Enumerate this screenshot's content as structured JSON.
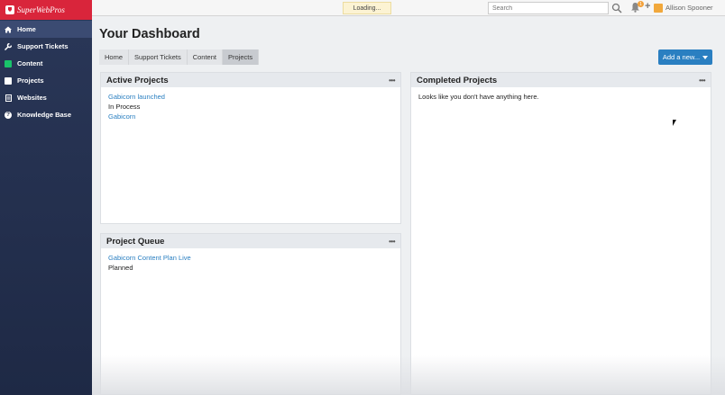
{
  "brand": {
    "name": "SuperWebPros",
    "color": "#d9253b"
  },
  "sidebar": {
    "items": [
      {
        "label": "Home",
        "icon": "home-icon",
        "active": true
      },
      {
        "label": "Support Tickets",
        "icon": "wrench-icon",
        "active": false
      },
      {
        "label": "Content",
        "icon": "content-icon",
        "active": false
      },
      {
        "label": "Projects",
        "icon": "projects-icon",
        "active": false
      },
      {
        "label": "Websites",
        "icon": "websites-icon",
        "active": false
      },
      {
        "label": "Knowledge Base",
        "icon": "question-icon",
        "active": false
      }
    ]
  },
  "topbar": {
    "loading_text": "Loading...",
    "search_placeholder": "Search",
    "notification_count": "1",
    "user_name": "Allison Spooner"
  },
  "main": {
    "title": "Your Dashboard",
    "tabs": [
      {
        "label": "Home",
        "active": false
      },
      {
        "label": "Support Tickets",
        "active": false
      },
      {
        "label": "Content",
        "active": false
      },
      {
        "label": "Projects",
        "active": true
      }
    ],
    "add_button_label": "Add a new...",
    "panels": {
      "active_projects": {
        "title": "Active Projects",
        "item_link": "Gabicorn launched",
        "item_status": "In Process",
        "item_client": "Gabicorn"
      },
      "project_queue": {
        "title": "Project Queue",
        "item_link": "Gabicorn Content Plan Live",
        "item_status": "Planned"
      },
      "completed_projects": {
        "title": "Completed Projects",
        "empty_text": "Looks like you don't have anything here."
      }
    },
    "more_glyph": "•••"
  },
  "colors": {
    "accent": "#2a7fc1",
    "sidebar": "#1e2945"
  }
}
